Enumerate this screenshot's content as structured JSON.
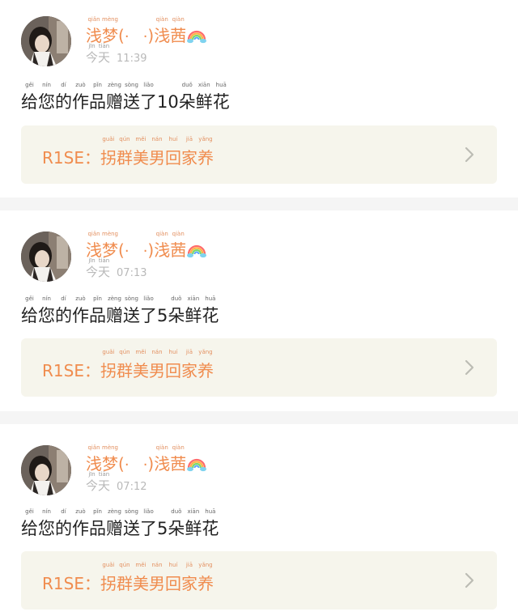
{
  "feed": [
    {
      "user": {
        "name_part1": "浅梦(",
        "name_dots": "·   ·",
        "name_part2": ")浅茜",
        "name_pinyin": [
          "qiǎn",
          "mèng",
          "",
          "",
          "qiàn",
          "qiàn"
        ],
        "avatar_icon": "user-avatar-photo",
        "badge_icon": "rainbow-icon"
      },
      "time": {
        "day": "今天",
        "day_pinyin": [
          "jīn",
          "tiān"
        ],
        "clock": "11:39"
      },
      "message": {
        "chars": [
          "给",
          "您",
          "的",
          "作",
          "品",
          "赠",
          "送",
          "了",
          "10",
          "朵",
          "鲜",
          "花"
        ],
        "pinyin": [
          "gěi",
          "nín",
          "dí",
          "zuò",
          "pǐn",
          "zèng",
          "sòng",
          "liǎo",
          "",
          "duǒ",
          "xiān",
          "huā"
        ]
      },
      "work": {
        "prefix": "R1SE：",
        "title_chars": [
          "拐",
          "群",
          "美",
          "男",
          "回",
          "家",
          "养"
        ],
        "title_pinyin": [
          "guǎi",
          "qún",
          "měi",
          "nán",
          "huí",
          "jiā",
          "yǎng"
        ],
        "chevron_icon": "chevron-right-icon"
      }
    },
    {
      "user": {
        "name_part1": "浅梦(",
        "name_dots": "·   ·",
        "name_part2": ")浅茜",
        "name_pinyin": [
          "qiǎn",
          "mèng",
          "",
          "",
          "qiàn",
          "qiàn"
        ],
        "avatar_icon": "user-avatar-photo",
        "badge_icon": "rainbow-icon"
      },
      "time": {
        "day": "今天",
        "day_pinyin": [
          "jīn",
          "tiān"
        ],
        "clock": "07:13"
      },
      "message": {
        "chars": [
          "给",
          "您",
          "的",
          "作",
          "品",
          "赠",
          "送",
          "了",
          "5",
          "朵",
          "鲜",
          "花"
        ],
        "pinyin": [
          "gěi",
          "nín",
          "dí",
          "zuò",
          "pǐn",
          "zèng",
          "sòng",
          "liǎo",
          "",
          "duǒ",
          "xiān",
          "huā"
        ]
      },
      "work": {
        "prefix": "R1SE：",
        "title_chars": [
          "拐",
          "群",
          "美",
          "男",
          "回",
          "家",
          "养"
        ],
        "title_pinyin": [
          "guǎi",
          "qún",
          "měi",
          "nán",
          "huí",
          "jiā",
          "yǎng"
        ],
        "chevron_icon": "chevron-right-icon"
      }
    },
    {
      "user": {
        "name_part1": "浅梦(",
        "name_dots": "·   ·",
        "name_part2": ")浅茜",
        "name_pinyin": [
          "qiǎn",
          "mèng",
          "",
          "",
          "qiàn",
          "qiàn"
        ],
        "avatar_icon": "user-avatar-photo",
        "badge_icon": "rainbow-icon"
      },
      "time": {
        "day": "今天",
        "day_pinyin": [
          "jīn",
          "tiān"
        ],
        "clock": "07:12"
      },
      "message": {
        "chars": [
          "给",
          "您",
          "的",
          "作",
          "品",
          "赠",
          "送",
          "了",
          "5",
          "朵",
          "鲜",
          "花"
        ],
        "pinyin": [
          "gěi",
          "nín",
          "dí",
          "zuò",
          "pǐn",
          "zèng",
          "sòng",
          "liǎo",
          "",
          "duǒ",
          "xiān",
          "huā"
        ]
      },
      "work": {
        "prefix": "R1SE：",
        "title_chars": [
          "拐",
          "群",
          "美",
          "男",
          "回",
          "家",
          "养"
        ],
        "title_pinyin": [
          "guǎi",
          "qún",
          "měi",
          "nán",
          "huí",
          "jiā",
          "yǎng"
        ],
        "chevron_icon": "chevron-right-icon"
      }
    }
  ],
  "colors": {
    "accent": "#f08c4e",
    "card_bg": "#f6f5ec",
    "divider": "#f5f5f5",
    "muted": "#b9b9b9",
    "text": "#222222"
  }
}
